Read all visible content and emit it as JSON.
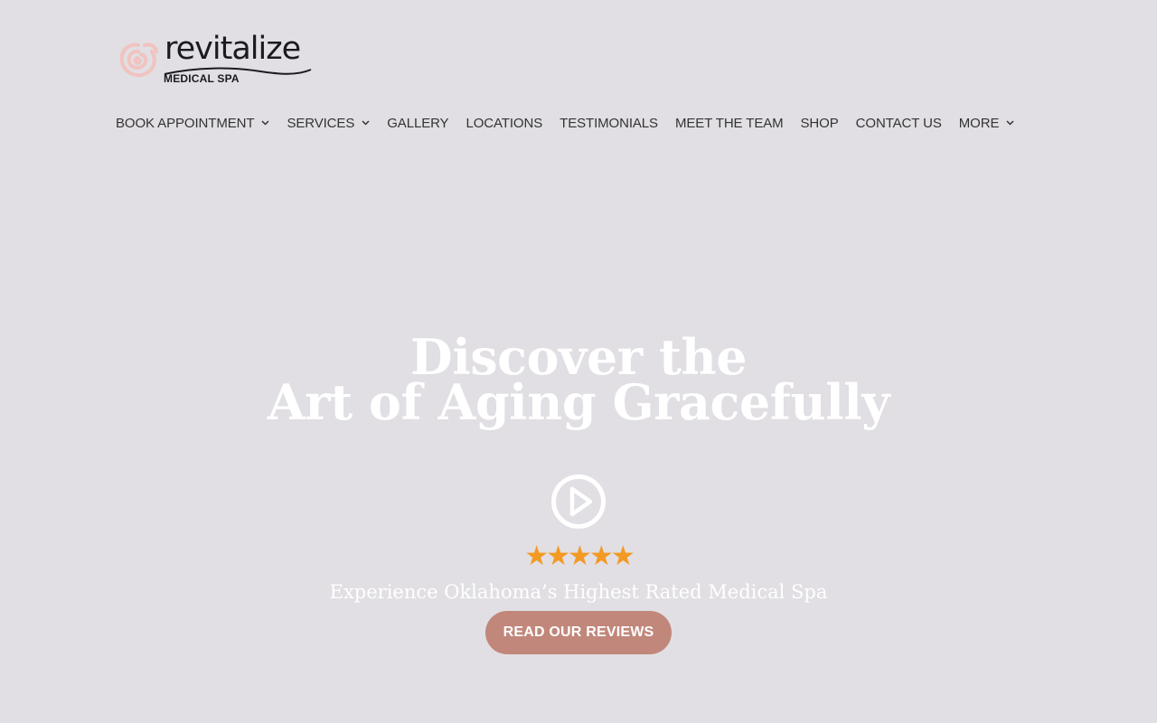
{
  "brand": {
    "name": "revitalize",
    "subtitle": "MEDICAL SPA",
    "logo_icon": "rose-icon",
    "logo_color": "#f2c6c4"
  },
  "nav": {
    "items": [
      {
        "label": "BOOK APPOINTMENT",
        "has_dropdown": true
      },
      {
        "label": "SERVICES",
        "has_dropdown": true
      },
      {
        "label": "GALLERY",
        "has_dropdown": false
      },
      {
        "label": "LOCATIONS",
        "has_dropdown": false
      },
      {
        "label": "TESTIMONIALS",
        "has_dropdown": false
      },
      {
        "label": "MEET THE TEAM",
        "has_dropdown": false
      },
      {
        "label": "SHOP",
        "has_dropdown": false
      },
      {
        "label": "CONTACT US",
        "has_dropdown": false
      },
      {
        "label": "MORE",
        "has_dropdown": true
      }
    ]
  },
  "hero": {
    "title_line1": "Discover the",
    "title_line2": "Art of Aging Gracefully",
    "play_icon": "play-circle-icon",
    "stars": "★★★★★",
    "rating": 5,
    "tagline": "Experience Oklahoma’s Highest Rated Medical Spa",
    "cta_label": "READ OUR REVIEWS"
  },
  "colors": {
    "background": "#e1dfe3",
    "cta": "#c1877b",
    "stars": "#f29a24",
    "nav_text": "#333333",
    "hero_text": "#ffffff"
  }
}
